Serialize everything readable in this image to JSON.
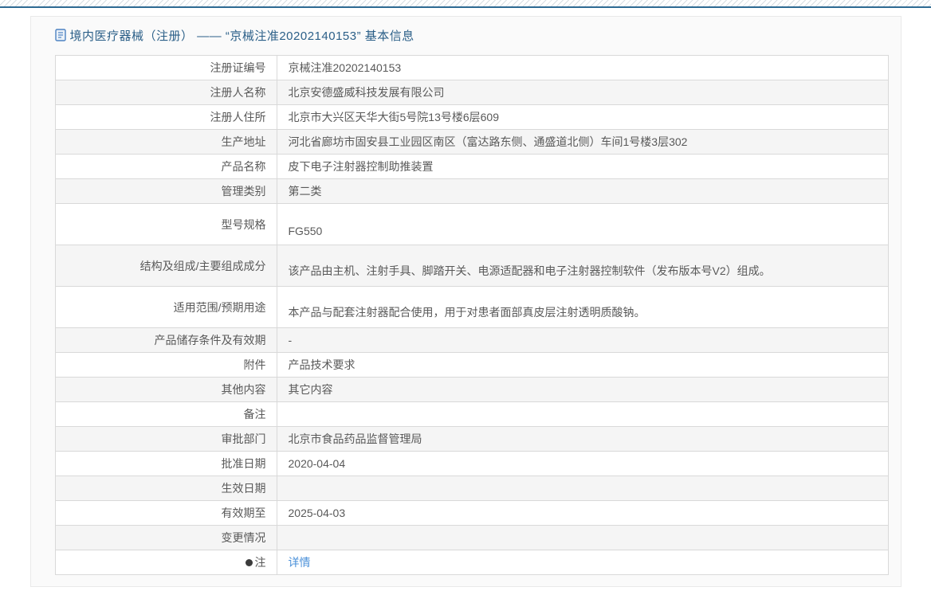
{
  "colors": {
    "accent": "#2e6a93",
    "title": "#2b5f88",
    "link": "#4a90d9"
  },
  "header": {
    "icon": "document-icon",
    "title": "境内医疗器械（注册） —— “京械注准20202140153” 基本信息"
  },
  "table": {
    "rows": [
      {
        "label": "注册证编号",
        "value": "京械注准20202140153"
      },
      {
        "label": "注册人名称",
        "value": "北京安德盛威科技发展有限公司"
      },
      {
        "label": "注册人住所",
        "value": "北京市大兴区天华大街5号院13号楼6层609"
      },
      {
        "label": "生产地址",
        "value": "河北省廊坊市固安县工业园区南区（富达路东侧、通盛道北侧）车间1号楼3层302"
      },
      {
        "label": "产品名称",
        "value": "皮下电子注射器控制助推装置"
      },
      {
        "label": "管理类别",
        "value": "第二类"
      },
      {
        "label": "型号规格",
        "value": "FG550",
        "tall": true
      },
      {
        "label": "结构及组成/主要组成成分",
        "value": "该产品由主机、注射手具、脚踏开关、电源适配器和电子注射器控制软件（发布版本号V2）组成。",
        "tall": true
      },
      {
        "label": "适用范围/预期用途",
        "value": "本产品与配套注射器配合使用，用于对患者面部真皮层注射透明质酸钠。",
        "tall": true
      },
      {
        "label": "产品储存条件及有效期",
        "value": "-"
      },
      {
        "label": "附件",
        "value": "产品技术要求"
      },
      {
        "label": "其他内容",
        "value": "其它内容"
      },
      {
        "label": "备注",
        "value": ""
      },
      {
        "label": "审批部门",
        "value": "北京市食品药品监督管理局"
      },
      {
        "label": "批准日期",
        "value": "2020-04-04"
      },
      {
        "label": "生效日期",
        "value": ""
      },
      {
        "label": "有效期至",
        "value": "2025-04-03"
      },
      {
        "label": "变更情况",
        "value": ""
      },
      {
        "label": "注",
        "value": "详情",
        "link": true,
        "icon": "note-bulb-icon"
      }
    ]
  }
}
